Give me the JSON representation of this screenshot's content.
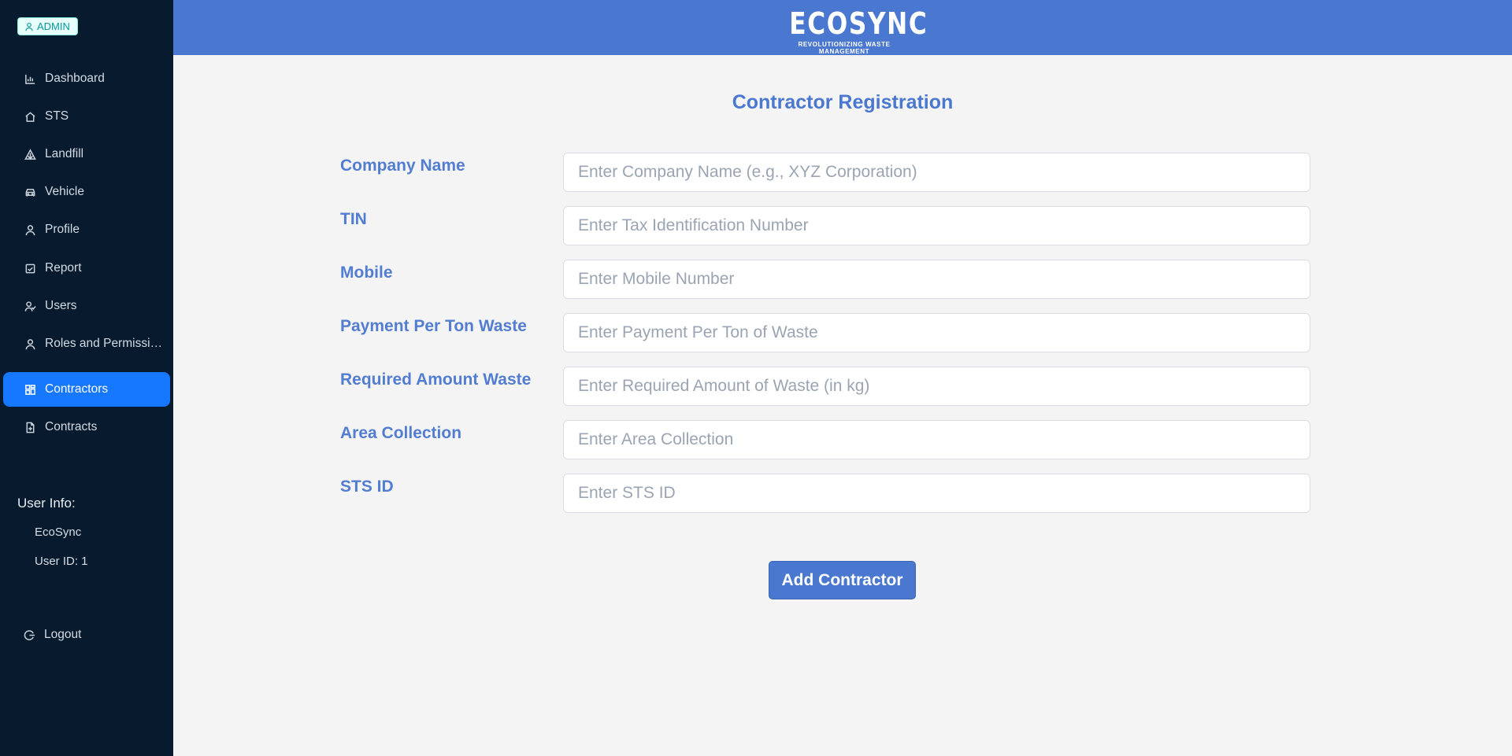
{
  "sidebar": {
    "role_badge": "ADMIN",
    "items": [
      {
        "label": "Dashboard",
        "icon": "bar-chart-icon"
      },
      {
        "label": "STS",
        "icon": "home-icon"
      },
      {
        "label": "Landfill",
        "icon": "landfill-icon"
      },
      {
        "label": "Vehicle",
        "icon": "car-icon"
      },
      {
        "label": "Profile",
        "icon": "user-icon"
      },
      {
        "label": "Report",
        "icon": "report-icon"
      },
      {
        "label": "Users",
        "icon": "users-icon"
      },
      {
        "label": "Roles and Permissions",
        "icon": "user-icon"
      },
      {
        "label": "Contractors",
        "icon": "grid-icon",
        "active": true
      },
      {
        "label": "Contracts",
        "icon": "file-icon"
      }
    ],
    "user_info": {
      "title": "User Info:",
      "name": "EcoSync",
      "user_id": "User ID: 1"
    },
    "logout_label": "Logout"
  },
  "header": {
    "logo_text": "ECOSYNC",
    "logo_tagline": "REVOLUTIONIZING WASTE MANAGEMENT"
  },
  "form": {
    "title": "Contractor Registration",
    "fields": [
      {
        "label": "Company Name",
        "placeholder": "Enter Company Name (e.g., XYZ Corporation)",
        "value": ""
      },
      {
        "label": "TIN",
        "placeholder": "Enter Tax Identification Number",
        "value": ""
      },
      {
        "label": "Mobile",
        "placeholder": "Enter Mobile Number",
        "value": ""
      },
      {
        "label": "Payment Per Ton Waste",
        "placeholder": "Enter Payment Per Ton of Waste",
        "value": ""
      },
      {
        "label": "Required Amount Waste",
        "placeholder": "Enter Required Amount of Waste (in kg)",
        "value": ""
      },
      {
        "label": "Area Collection",
        "placeholder": "Enter Area Collection",
        "value": ""
      },
      {
        "label": "STS ID",
        "placeholder": "Enter STS ID",
        "value": ""
      }
    ],
    "submit_label": "Add Contractor"
  },
  "colors": {
    "sidebar_bg": "#071a2e",
    "header_bg": "#4a77cf",
    "active_item": "#1677ff",
    "accent": "#4a77cf",
    "page_bg": "#f4f4f4"
  }
}
